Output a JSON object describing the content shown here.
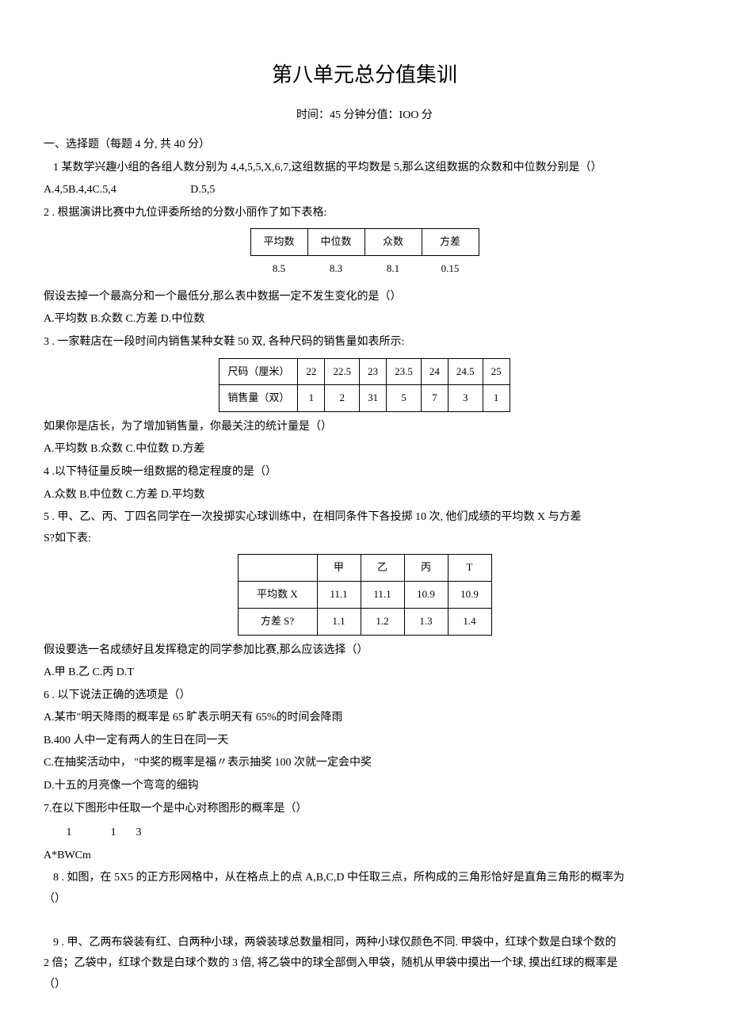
{
  "title": "第八单元总分值集训",
  "subtitle": "时间：45 分钟分值：IOO 分",
  "section1": {
    "heading": "一、选择题（每题 4 分, 共 40 分）",
    "q1": "1 某数学兴趣小组的各组人数分别为 4,4,5,5,X,6,7,这组数据的平均数是 5,那么这组数据的众数和中位数分别是（）",
    "q1_opts_a": "A.4,5B.4,4C.5,4",
    "q1_opts_b": "D.5,5",
    "q2": "2  . 根据演讲比赛中九位评委所给的分数小丽作了如下表格:",
    "q2_table": {
      "h1": "平均数",
      "h2": "中位数",
      "h3": "众数",
      "h4": "方差",
      "v1": "8.5",
      "v2": "8.3",
      "v3": "8.1",
      "v4": "0.15"
    },
    "q2_after": "假设去掉一个最高分和一个最低分,那么表中数据一定不发生变化的是（）",
    "q2_opts": "A.平均数 B.众数 C.方差 D.中位数",
    "q3": "3  . 一家鞋店在一段时间内销售某种女鞋 50 双, 各种尺码的销售量如表所示:",
    "q3_table": {
      "r1": [
        "尺码（厘米）",
        "22",
        "22.5",
        "23",
        "23.5",
        "24",
        "24.5",
        "25"
      ],
      "r2": [
        "销售量（双）",
        "1",
        "2",
        "31",
        "5",
        "7",
        "3",
        "1"
      ]
    },
    "q3_after": "如果你是店长，为了增加销售量，你最关注的统计量是（）",
    "q3_opts": "A.平均数 B.众数 C.中位数 D.方差",
    "q4": "4  .以下特征量反映一组数据的稳定程度的是（）",
    "q4_opts": "A.众数 B.中位数 C.方差 D.平均数",
    "q5a": "5  . 甲、乙、丙、丁四名同学在一次投掷实心球训练中，在相同条件下各投掷 10 次, 他们成绩的平均数 X 与方差",
    "q5b": "S?如下表:",
    "q5_table": {
      "h": [
        "",
        "甲",
        "乙",
        "丙",
        "T"
      ],
      "r1": [
        "平均数 X",
        "11.1",
        "11.1",
        "10.9",
        "10.9"
      ],
      "r2": [
        "方差 S?",
        "1.1",
        "1.2",
        "1.3",
        "1.4"
      ]
    },
    "q5_after": "假设要选一名成绩好且发挥稳定的同学参加比赛,那么应该选择（）",
    "q5_opts": "A.甲 B.乙 C.丙 D.T",
    "q6": "6  . 以下说法正确的选项是（）",
    "q6a": "A.某市\"明天降雨的概率是 65 旷表示明天有 65%的时间会降雨",
    "q6b": "B.400 人中一定有两人的生日在同一天",
    "q6c": "C.在抽奖活动中， \"中奖的概率是福〃表示抽奖 100 次就一定会中奖",
    "q6d": "D.十五的月亮像一个弯弯的细钩",
    "q7": "7.在以下图形中任取一个是中心对称图形的概率是（）",
    "q7_frac": {
      "n1": "1",
      "n2": "1",
      "n3": "3"
    },
    "q7_opts": "A*BWCm",
    "q8a": "8  . 如图，在 5X5 的正方形网格中，从在格点上的点 A,B,C,D 中任取三点，所构成的三角形恰好是直角三角形的概率为",
    "q8b": "（）",
    "q9a": "9  . 甲、乙两布袋装有红、白两种小球，两袋装球总数量相同，两种小球仅颜色不同. 甲袋中，红球个数是白球个数的",
    "q9b": "2 倍；乙袋中，红球个数是白球个数的 3 倍, 将乙袋中的球全部倒入甲袋，随机从甲袋中摸出一个球, 摸出红球的概率是",
    "q9c": "（）"
  }
}
